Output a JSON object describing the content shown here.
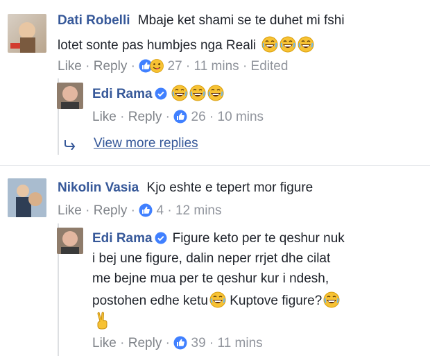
{
  "comments": [
    {
      "author": "Dati Robelli",
      "text_line1": "Mbaje ket shami se te duhet mi fshi",
      "text_line2": "lotet sonte pas humbjes nga Reali",
      "actions": {
        "like": "Like",
        "reply": "Reply",
        "count": "27",
        "time": "11 mins",
        "edited": "Edited"
      },
      "reply": {
        "author": "Edi Rama",
        "actions": {
          "like": "Like",
          "reply": "Reply",
          "count": "26",
          "time": "10 mins"
        }
      },
      "view_more": "View more replies"
    },
    {
      "author": "Nikolin Vasia",
      "text": "Kjo eshte e tepert mor figure",
      "actions": {
        "like": "Like",
        "reply": "Reply",
        "count": "4",
        "time": "12 mins"
      },
      "reply": {
        "author": "Edi Rama",
        "text_line1": "Figure keto per te qeshur nuk",
        "text_line2": "i bej une figure, dalin neper rrjet dhe cilat",
        "text_line3": "me bejne mua per te qeshur kur i ndesh,",
        "text_line4a": "postohen edhe ketu",
        "text_line4b": "Kuptove figure?",
        "actions": {
          "like": "Like",
          "reply": "Reply",
          "count": "39",
          "time": "11 mins"
        }
      }
    }
  ],
  "separator": "·",
  "colors": {
    "name": "#365899",
    "meta": "#90949c",
    "like_blue": "#4080ff",
    "emoji_yellow": "#f7c234"
  }
}
